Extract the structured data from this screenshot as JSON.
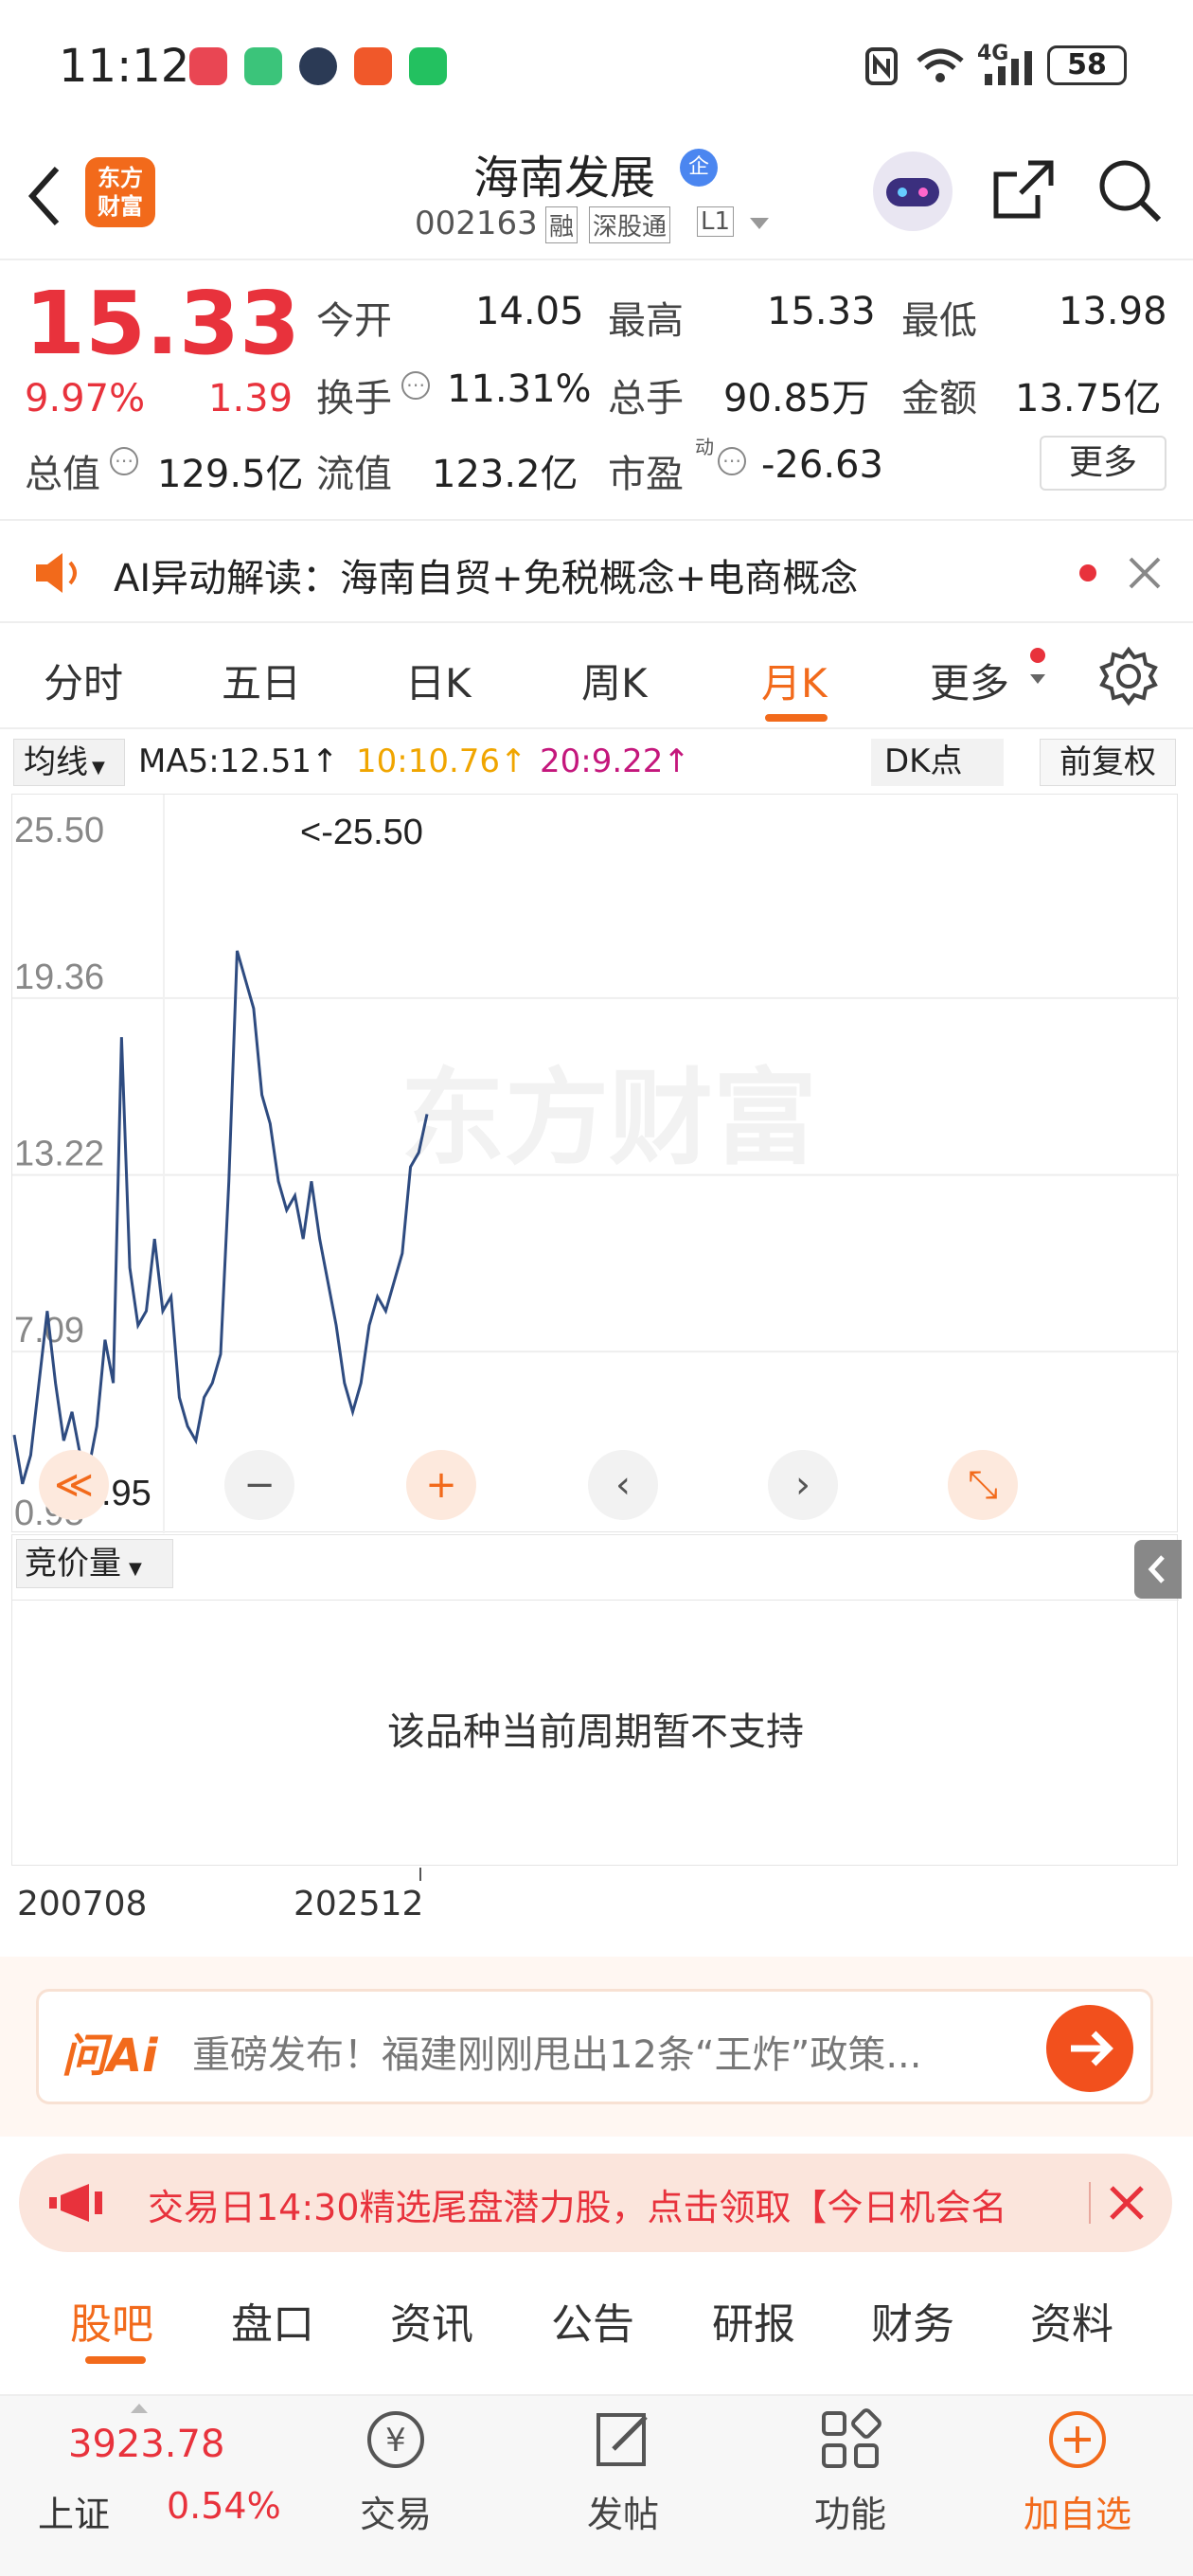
{
  "status": {
    "time": "11:12",
    "battery": "58",
    "network": "4G"
  },
  "header": {
    "title": "海南发展",
    "code": "002163",
    "tags": [
      "融",
      "深股通",
      "L1"
    ],
    "logo_text_1": "东方",
    "logo_text_2": "财富",
    "tag_enterprise": "企"
  },
  "quote": {
    "price": "15.33",
    "change_pct": "9.97%",
    "change": "1.39",
    "open_label": "今开",
    "open": "14.05",
    "high_label": "最高",
    "high": "15.33",
    "low_label": "最低",
    "low": "13.98",
    "turnover_label": "换手",
    "turnover": "11.31%",
    "volume_label": "总手",
    "volume": "90.85万",
    "amount_label": "金额",
    "amount": "13.75亿",
    "mktcap_label": "总值",
    "mktcap": "129.5亿",
    "float_label": "流值",
    "float": "123.2亿",
    "pe_label": "市盈",
    "pe_sup": "动",
    "pe": "-26.63",
    "more": "更多"
  },
  "ai_banner": {
    "text": "AI异动解读：海南自贸+免税概念+电商概念"
  },
  "tabs": [
    "分时",
    "五日",
    "日K",
    "周K",
    "月K",
    "更多"
  ],
  "active_tab": "月K",
  "ma": {
    "selector": "均线",
    "ma5": "MA5:12.51↑",
    "ma10": "10:10.76↑",
    "ma20": "20:9.22↑",
    "dk": "DK点",
    "adjust": "前复权"
  },
  "chart_data": {
    "type": "line",
    "y_ticks": [
      "25.50",
      "19.36",
      "13.22",
      "7.09",
      "0.95"
    ],
    "max_marker": "<-25.50",
    "min_marker": "<-0.95",
    "ylim": [
      0.95,
      25.5
    ],
    "x_labels": [
      "200708",
      "202512"
    ],
    "x": [
      0,
      2,
      4,
      6,
      8,
      10,
      12,
      14,
      16,
      18,
      20,
      22,
      24,
      26,
      28,
      30,
      32,
      34,
      36,
      38,
      40,
      42,
      44,
      46,
      48,
      50,
      52,
      54,
      56,
      58,
      60,
      62,
      64,
      66,
      68,
      70,
      72,
      74,
      76,
      78,
      80,
      82,
      84,
      86,
      88,
      90,
      92,
      94,
      96,
      98,
      100
    ],
    "values": [
      4.2,
      2.5,
      3.5,
      6.0,
      8.5,
      6.0,
      4.0,
      5.0,
      3.5,
      3.0,
      4.5,
      7.5,
      6.0,
      18.0,
      10.0,
      8.0,
      8.5,
      11.0,
      8.5,
      9.0,
      5.5,
      4.5,
      4.0,
      5.5,
      6.0,
      7.0,
      13.0,
      21.0,
      20.0,
      19.0,
      16.0,
      15.0,
      13.0,
      12.0,
      12.5,
      11.0,
      13.0,
      11.0,
      9.5,
      8.0,
      6.0,
      5.0,
      6.0,
      8.0,
      9.0,
      8.5,
      9.5,
      10.5,
      13.5,
      14.0,
      15.33
    ]
  },
  "chart_controls": [
    "≪",
    "−",
    "+",
    "‹",
    "›",
    "⤡"
  ],
  "sub_indicator": {
    "selector": "竞价量",
    "message": "该品种当前周期暂不支持"
  },
  "news_bar": {
    "brand": "问Ai",
    "text": "重磅发布！福建刚刚甩出12条“王炸”政策..."
  },
  "promo": {
    "text": "交易日14:30精选尾盘潜力股，点击领取【今日机会名"
  },
  "bottom_tabs": [
    "股吧",
    "盘口",
    "资讯",
    "公告",
    "研报",
    "财务",
    "资料"
  ],
  "index": {
    "value": "3923.78",
    "name": "上证",
    "pct": "0.54%"
  },
  "nav": [
    {
      "label": "交易"
    },
    {
      "label": "发帖"
    },
    {
      "label": "功能"
    },
    {
      "label": "加自选"
    }
  ],
  "watermark": "东方财富",
  "colors": {
    "red": "#e8323c",
    "orange": "#f26a1b",
    "line": "#2e4b80"
  }
}
